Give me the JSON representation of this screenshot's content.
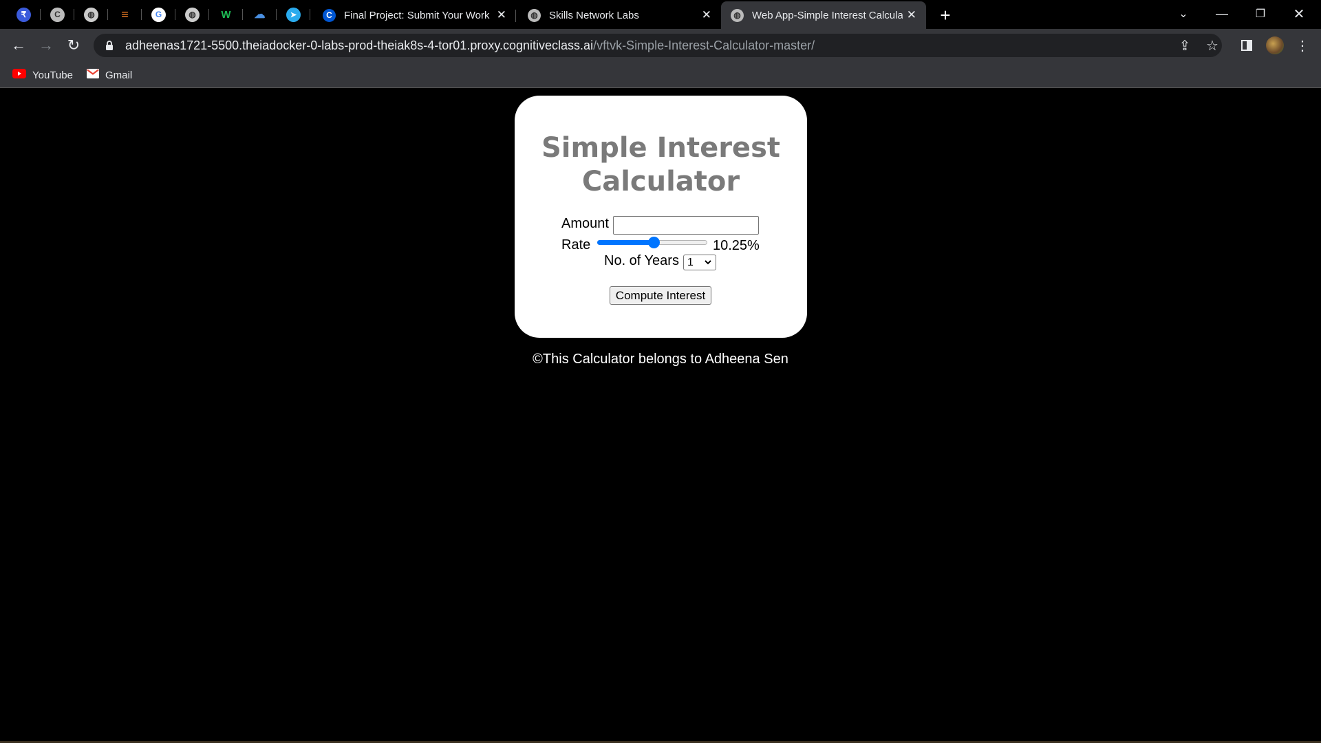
{
  "browser": {
    "tabs": [
      {
        "title": "Final Project: Submit Your Work and",
        "icon": "coursera-icon"
      },
      {
        "title": "Skills Network Labs",
        "icon": "globe-icon"
      },
      {
        "title": "Web App-Simple Interest Calculator",
        "icon": "globe-icon"
      }
    ],
    "active_tab": 2,
    "url_host": "adheenas1721-5500.theiadocker-0-labs-prod-theiak8s-4-tor01.proxy.cognitiveclass.ai",
    "url_path": "/vftvk-Simple-Interest-Calculator-master/",
    "bookmarks": [
      {
        "label": "YouTube",
        "icon": "youtube-icon"
      },
      {
        "label": "Gmail",
        "icon": "gmail-icon"
      }
    ]
  },
  "page": {
    "heading": "Simple Interest Calculator",
    "amount_label": "Amount",
    "amount_value": "",
    "rate_label": "Rate",
    "rate_value": 10.25,
    "rate_max": 20,
    "rate_display": "10.25%",
    "years_label": "No. of Years",
    "years_value": "1",
    "compute_label": "Compute Interest",
    "footer": "©This Calculator belongs to Adheena Sen"
  },
  "colors": {
    "heading": "#7a7a7a",
    "accent": "#0075ff",
    "background": "#000000"
  }
}
